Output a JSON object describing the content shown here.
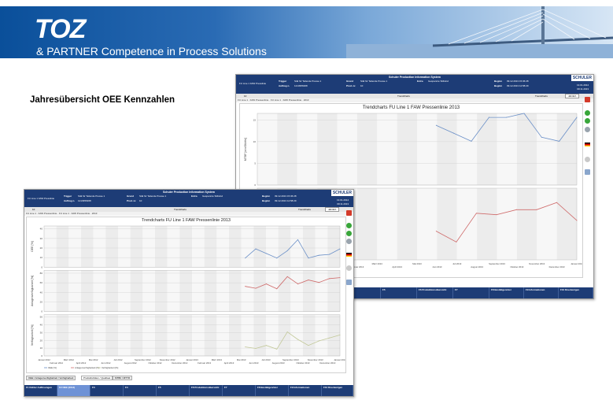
{
  "banner": {
    "logo_text": "TOZ",
    "tagline": "& PARTNER  Competence in Process Solutions"
  },
  "heading": "Jahresübersicht OEE Kennzahlen",
  "app": {
    "system_title": "Schuler Production Information System",
    "brand": "SCHULER",
    "line_name": "FU Line 1  FAW Presslinie",
    "fields": {
      "trigger_label": "Trigger",
      "trigger_value": "Stäl für Teilende Presse 1",
      "auftrag_label": "Auftrag n.",
      "auftrag_value": "1213956368",
      "grund_label": "Grund",
      "grund_value": "Stäl für Teilende Presse 1",
      "prod_label": "Prod. nr.",
      "prod_value": "10",
      "extra_label": "Extra",
      "extra_value": "Gespannte Stillstnd",
      "beginn_label": "Beginn",
      "beginn_value": "09.12.2013 15:36:28",
      "ende_label": "Beginn",
      "ende_value": "09.12.2013 12:58:29",
      "date": "13.01.2014",
      "time": "09:11.2013"
    },
    "tabrow_left": "10",
    "tabrow_center": "Trendcharts",
    "tabrow_right": "Trendcharts",
    "tabrow_select": "Jährlich",
    "breadcrumb": "FU Line 1 · FAW Pressenlinie · FU Line 1 · FAW Pressenlinie · 2013",
    "bottom": [
      {
        "top": "F1",
        "label": "Kühler Auflösungen"
      },
      {
        "top": "F2",
        "label": "OEE (2013)"
      },
      {
        "top": "F3",
        "label": ""
      },
      {
        "top": "F4",
        "label": ""
      },
      {
        "top": "F5",
        "label": ""
      },
      {
        "top": "F6",
        "label": "Produktionsübersicht"
      },
      {
        "top": "F7",
        "label": ""
      },
      {
        "top": "F8",
        "label": "Bestätigen/ster"
      },
      {
        "top": "F9",
        "label": "Informationen"
      },
      {
        "top": "F10",
        "label": "Drucken/gen"
      }
    ],
    "window_tabs": [
      "OEE / Anlagenverfügbarkeit / Verfügbarkeit",
      "Produktivitäten / Qualitaet",
      "MTBF / MTTR"
    ]
  },
  "chart_data": [
    {
      "type": "line",
      "title": "Trendcharts  FU Line 1  FAW Pressenlinie 2013",
      "x_top": [
        "Januar 2012",
        "März 2012",
        "Mai 2012",
        "Juli 2012",
        "September 2012",
        "November 2012",
        "Januar 2013",
        "März 2013",
        "Mai 2013",
        "Juli 2013",
        "September 2013",
        "November 2013",
        "Januar 2014"
      ],
      "x_bottom": [
        "Februar 2012",
        "April 2012",
        "Juni 2012",
        "August 2012",
        "Oktober 2012",
        "Dezember 2012",
        "Februar 2013",
        "April 2013",
        "Juni 2013",
        "August 2013",
        "Oktober 2013",
        "Dezember 2013"
      ],
      "panels": [
        {
          "ylabel": "OEE [%]",
          "yticks": [
            "0",
            "10",
            "20",
            "30",
            "40"
          ],
          "ylim": [
            0,
            45
          ],
          "color": "#6a8fc7",
          "values": [
            10,
            20,
            15,
            10,
            18,
            30,
            10,
            13,
            14,
            20
          ]
        },
        {
          "ylabel": "Anlagenverfügbarkeit [%]",
          "yticks": [
            "0",
            "20",
            "40",
            "60",
            "80"
          ],
          "ylim": [
            0,
            85
          ],
          "color": "#cf6b6b",
          "values": [
            52,
            48,
            57,
            47,
            72,
            57,
            65,
            60,
            68,
            70
          ]
        },
        {
          "ylabel": "Verfügbarkeit [%]",
          "yticks": [
            "0",
            "10",
            "20",
            "30",
            "40",
            "50"
          ],
          "ylim": [
            0,
            55
          ],
          "color": "#c2c898",
          "values": [
            12,
            10,
            14,
            9,
            32,
            22,
            14,
            20,
            24,
            28
          ]
        }
      ],
      "legend": [
        "OEE [%]",
        "Anlagenverfügbarkeit [%]",
        "Verfügbarkeit [%]"
      ]
    },
    {
      "type": "line",
      "title": "Trendcharts  FU Line 1  FAW Pressenlinie 2013",
      "x_top": [
        "September 2012",
        "November 2012",
        "Januar 2013",
        "März 2013",
        "Mai 2013",
        "Juli 2013",
        "September 2013",
        "November 2013",
        "Januar 2014"
      ],
      "x_bottom": [
        "Oktober 2012",
        "Dezember 2012",
        "Februar 2013",
        "April 2013",
        "Juni 2013",
        "August 2013",
        "Oktober 2013",
        "Dezember 2013"
      ],
      "panels": [
        {
          "ylabel": "MTBF [min/Störfm]",
          "yticks": [
            "0",
            "5",
            "10",
            "15"
          ],
          "ylim": [
            0,
            18
          ],
          "color": "#6a8fc7",
          "values": [
            15,
            13,
            11,
            17,
            17,
            18,
            12,
            11,
            17
          ]
        },
        {
          "ylabel": "",
          "yticks": [],
          "ylim": [
            0,
            100
          ],
          "color": "#cf6b6b",
          "values": [
            40,
            25,
            65,
            63,
            70,
            70,
            80,
            55
          ]
        }
      ]
    }
  ]
}
